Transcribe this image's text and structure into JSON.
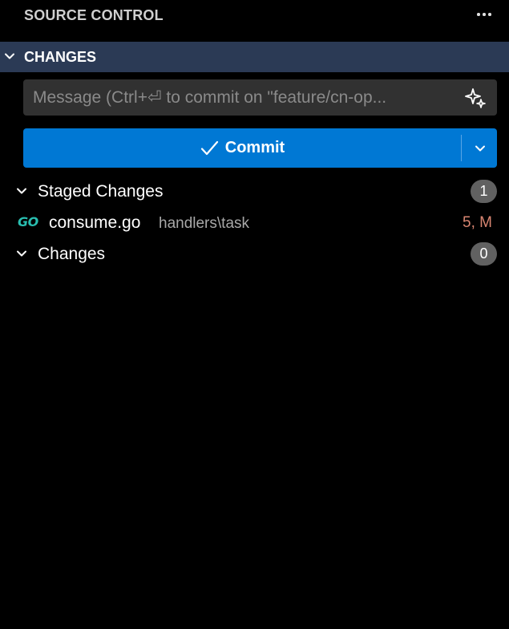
{
  "header": {
    "title": "SOURCE CONTROL",
    "more_icon": "ellipsis-icon"
  },
  "section": {
    "title": "CHANGES",
    "chevron_icon": "chevron-down-icon",
    "band_color": "#2b3a55"
  },
  "message": {
    "placeholder": "Message (Ctrl+⏎ to commit on \"feature/cn-op...",
    "value": "",
    "sparkle_icon": "sparkle-icon"
  },
  "commit": {
    "label": "Commit",
    "check_icon": "check-icon",
    "dropdown_icon": "chevron-down-icon",
    "color": "#0078d4"
  },
  "groups": [
    {
      "label": "Staged Changes",
      "count": "1",
      "files": [
        {
          "icon": "go-file-icon",
          "icon_text": "GO",
          "name": "consume.go",
          "path": "handlers\\task",
          "status": "5, M"
        }
      ]
    },
    {
      "label": "Changes",
      "count": "0",
      "files": []
    }
  ],
  "colors": {
    "status_modified": "#d98672",
    "badge_bg": "#616161",
    "go_icon": "#29beb0"
  }
}
